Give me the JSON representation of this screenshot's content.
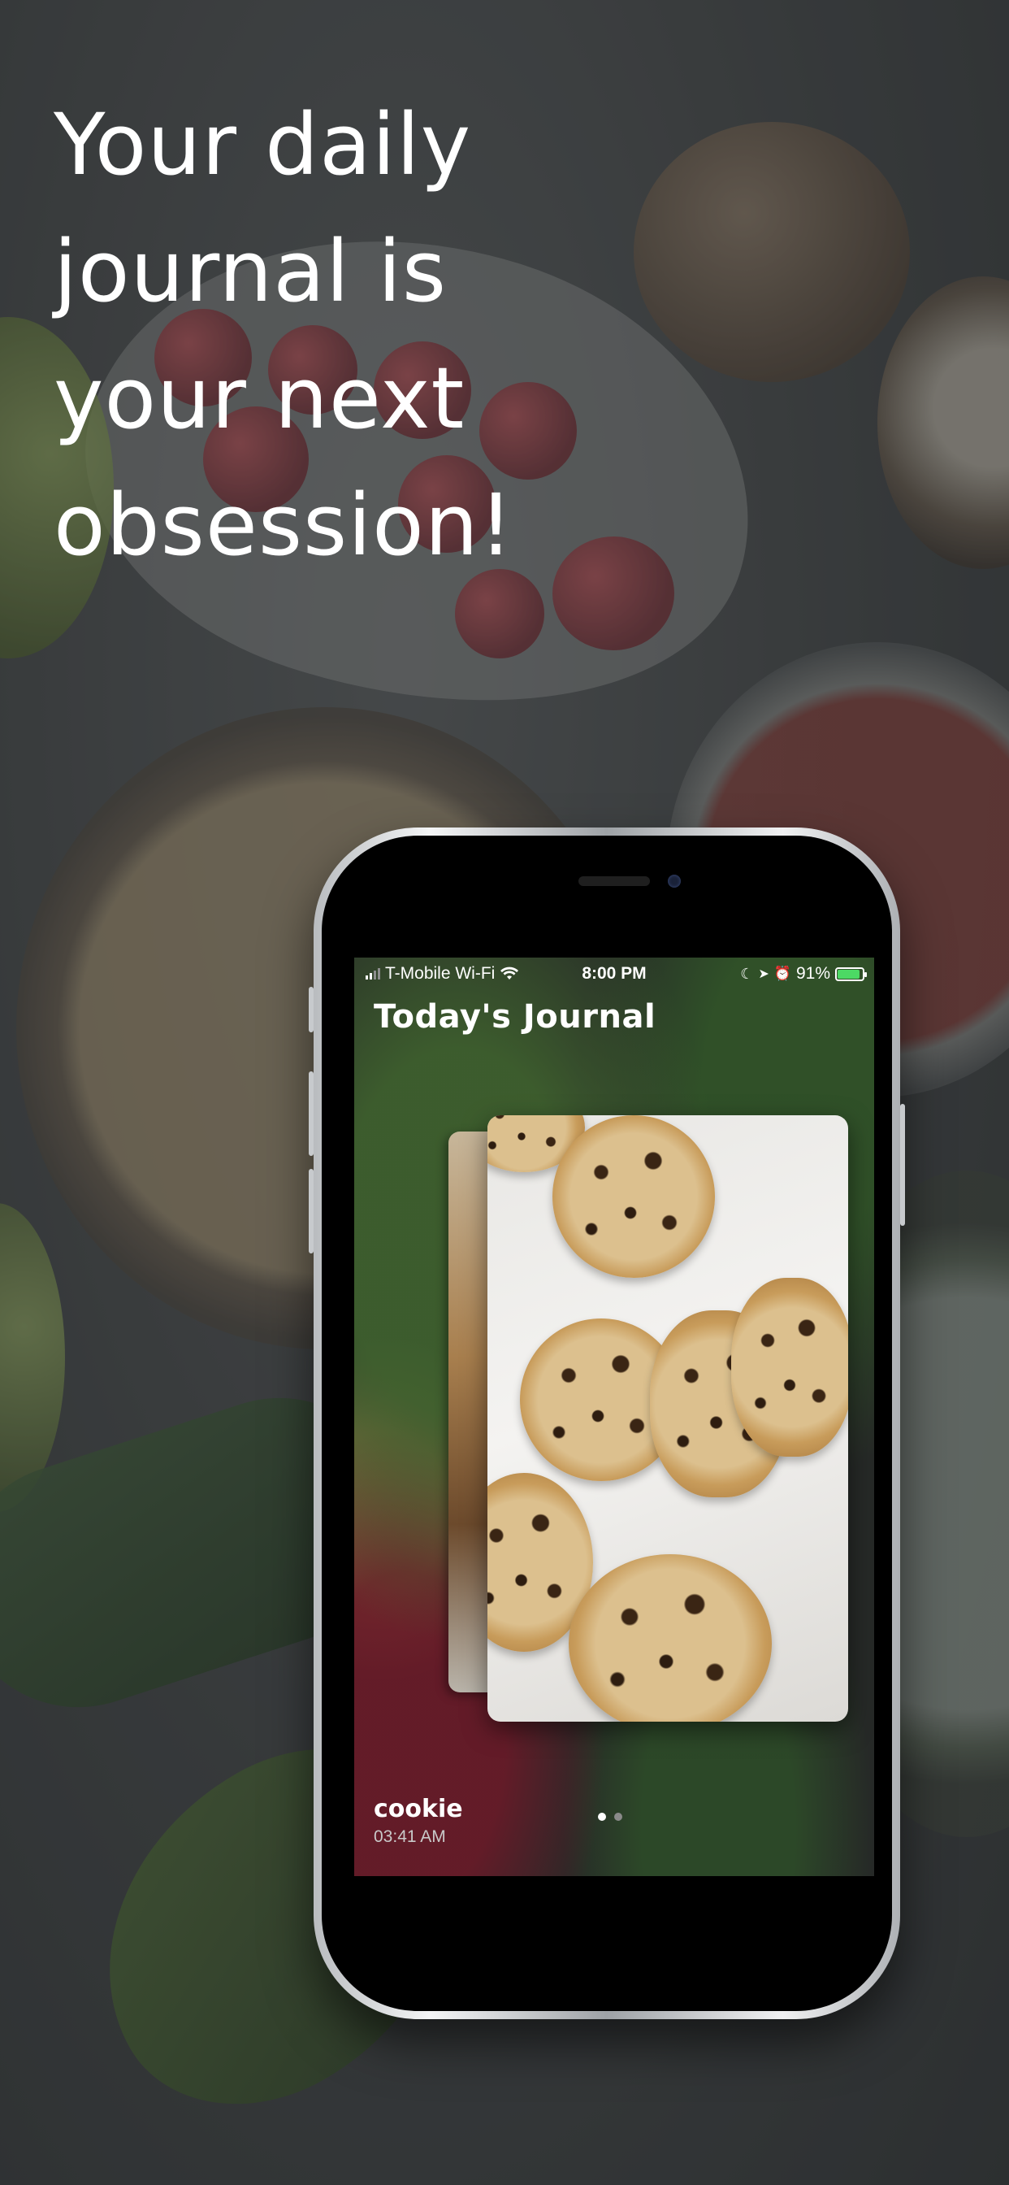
{
  "headline": "Your daily journal is your next obsession!",
  "status_bar": {
    "carrier": "T-Mobile Wi-Fi",
    "time": "8:00 PM",
    "battery": "91%",
    "battery_level": 0.91
  },
  "app": {
    "title": "Today's Journal",
    "entry": {
      "name": "cookie",
      "time": "03:41 AM"
    },
    "pager": {
      "pages": 2,
      "current": 1
    }
  },
  "icons": [
    "wifi-icon",
    "signal-icon",
    "moon-icon",
    "location-icon",
    "alarm-icon",
    "battery-icon"
  ],
  "colors": {
    "accent_battery": "#4cd964",
    "text_primary": "#ffffff"
  }
}
